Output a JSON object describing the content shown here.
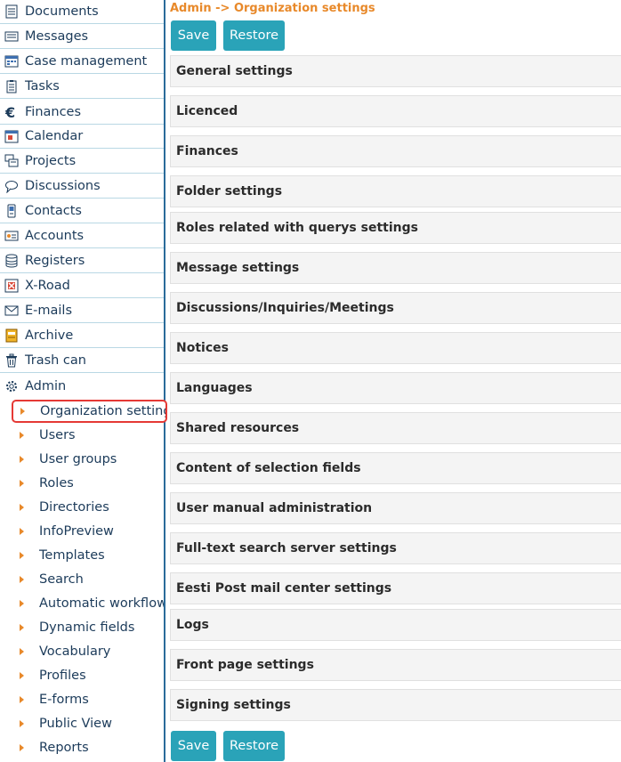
{
  "sidebar": {
    "items": [
      {
        "label": "Documents",
        "icon": "document-icon"
      },
      {
        "label": "Messages",
        "icon": "messages-icon"
      },
      {
        "label": "Case management",
        "icon": "case-management-icon"
      },
      {
        "label": "Tasks",
        "icon": "tasks-icon"
      },
      {
        "label": "Finances",
        "icon": "euro-icon"
      },
      {
        "label": "Calendar",
        "icon": "calendar-icon"
      },
      {
        "label": "Projects",
        "icon": "projects-icon"
      },
      {
        "label": "Discussions",
        "icon": "discussions-icon"
      },
      {
        "label": "Contacts",
        "icon": "contacts-icon"
      },
      {
        "label": "Accounts",
        "icon": "accounts-icon"
      },
      {
        "label": "Registers",
        "icon": "registers-icon"
      },
      {
        "label": "X-Road",
        "icon": "x-road-icon"
      },
      {
        "label": "E-mails",
        "icon": "email-icon"
      },
      {
        "label": "Archive",
        "icon": "archive-icon"
      },
      {
        "label": "Trash can",
        "icon": "trash-icon"
      },
      {
        "label": "Admin",
        "icon": "gear-icon"
      }
    ],
    "admin_sub_items": [
      {
        "label": "Organization settings",
        "selected": true
      },
      {
        "label": "Users"
      },
      {
        "label": "User groups"
      },
      {
        "label": "Roles"
      },
      {
        "label": "Directories"
      },
      {
        "label": "InfoPreview"
      },
      {
        "label": "Templates"
      },
      {
        "label": "Search"
      },
      {
        "label": "Automatic workflow"
      },
      {
        "label": "Dynamic fields"
      },
      {
        "label": "Vocabulary"
      },
      {
        "label": "Profiles"
      },
      {
        "label": "E-forms"
      },
      {
        "label": "Public View"
      },
      {
        "label": "Reports"
      }
    ]
  },
  "main": {
    "breadcrumb": "Admin -> Organization settings",
    "save_label": "Save",
    "restore_label": "Restore",
    "sections": [
      "General settings",
      "Licenced",
      "Finances",
      "Folder settings",
      "Roles related with querys settings",
      "Message settings",
      "Discussions/Inquiries/Meetings",
      "Notices",
      "Languages",
      "Shared resources",
      "Content of selection fields",
      "User manual administration",
      "Full-text search server settings",
      "Eesti Post mail center settings",
      "Logs",
      "Front page settings",
      "Signing settings"
    ]
  },
  "colors": {
    "accent_orange": "#e8892a",
    "button_teal": "#2aa3b8",
    "selection_red": "#e53935",
    "sidebar_border": "#2a6b9a"
  }
}
